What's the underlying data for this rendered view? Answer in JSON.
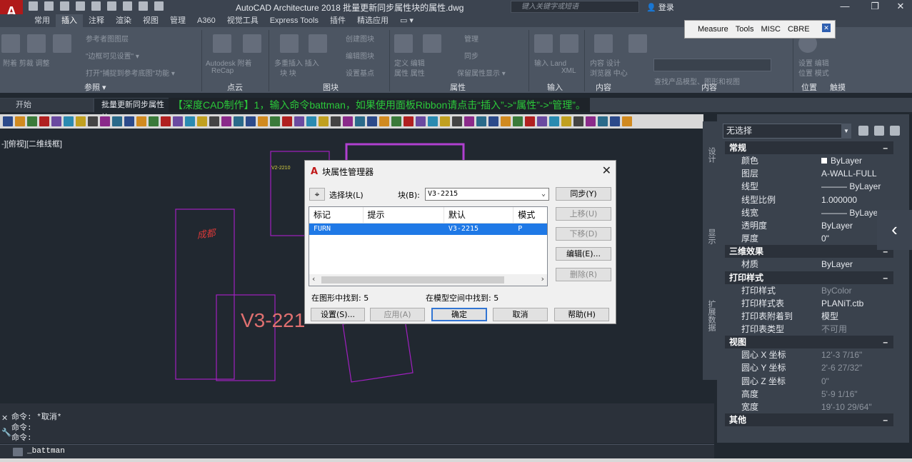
{
  "window": {
    "title": "AutoCAD Architecture 2018   批量更新同步属性块的属性.dwg",
    "search_placeholder": "键入关键字或短语",
    "login": "登录",
    "minimize": "—",
    "restore": "❐",
    "close": "✕"
  },
  "ribbon_tabs": [
    "常用",
    "插入",
    "注释",
    "渲染",
    "视图",
    "管理",
    "A360",
    "视觉工具",
    "Express Tools",
    "插件",
    "精选应用",
    "▭ ▾"
  ],
  "ribbon_active_tab": "插入",
  "floating_toolbar": [
    "Measure",
    "Tools",
    "MISC",
    "CBRE"
  ],
  "ribbon": {
    "panels": [
      "参照 ▾",
      "点云",
      "图块",
      "属性",
      "输入",
      "内容",
      "内容",
      "位置",
      "触摸"
    ],
    "faded_labels": {
      "ref1": "参考者图图层",
      "ref2": "\"边框可见设置\" ▾",
      "ref3": "打开\"捕捉到参考底图\"功能 ▾",
      "attach": "附着  剪裁  调整",
      "autodesk": "Autodesk  附着",
      "recap": "ReCap",
      "block_items": "多重插入  插入",
      "block_blocks": "块    块",
      "create": "创建图块",
      "edit": "编辑图块",
      "setbase": "设置基点",
      "manage": "管理",
      "sync": "同步",
      "hide": "保留属性显示 ▾",
      "define": "定义  编辑",
      "attr": "属性  属性",
      "import": "输入  Land",
      "xml": "XML",
      "content_browser": "内容  设计",
      "content_center": "浏览器  中心",
      "search_hint": "查找产品模型、图形和视图",
      "location": "设置  编辑",
      "location2": "位置  模式"
    }
  },
  "file_tabs": {
    "start": "开始",
    "doc": "批量更新同步属性块"
  },
  "banner": "【深度CAD制作】1，输入命令battman，如果使用面板Ribbon请点击“插入”->“属性”->“管理”。",
  "viewport_label": "-][俯视][二维线框]",
  "drawing": {
    "small_label": "V2-2210",
    "red_label": "成都",
    "big_label": "V3-221"
  },
  "dialog": {
    "title": "块属性管理器",
    "select_block": "选择块(L)",
    "block_label": "块(B):",
    "block_value": "V3-2215",
    "columns": [
      "标记",
      "提示",
      "默认",
      "模式"
    ],
    "rows": [
      {
        "tag": "FURN",
        "prompt": "",
        "default": "V3-2215",
        "mode": "P"
      }
    ],
    "buttons": {
      "sync": "同步(Y)",
      "move_up": "上移(U)",
      "move_down": "下移(D)",
      "edit": "编辑(E)...",
      "delete": "删除(R)",
      "settings": "设置(S)...",
      "apply": "应用(A)",
      "ok": "确定",
      "cancel": "取消",
      "help": "帮助(H)"
    },
    "found_drawing": "在图形中找到: 5",
    "found_model": "在模型空间中找到: 5"
  },
  "palette": {
    "selection": "无选择",
    "side_tabs": [
      "设计",
      "显示",
      "扩展数据"
    ],
    "sections": [
      {
        "title": "常规",
        "rows": [
          {
            "k": "颜色",
            "v": "ByLayer",
            "swatch": true
          },
          {
            "k": "图层",
            "v": "A-WALL-FULL"
          },
          {
            "k": "线型",
            "v": "——— ByLayer"
          },
          {
            "k": "线型比例",
            "v": "1.000000"
          },
          {
            "k": "线宽",
            "v": "——— ByLayer"
          },
          {
            "k": "透明度",
            "v": "ByLayer"
          },
          {
            "k": "厚度",
            "v": "0\""
          }
        ]
      },
      {
        "title": "三维效果",
        "rows": [
          {
            "k": "材质",
            "v": "ByLayer"
          }
        ]
      },
      {
        "title": "打印样式",
        "rows": [
          {
            "k": "打印样式",
            "v": "ByColor",
            "dim": true
          },
          {
            "k": "打印样式表",
            "v": "PLANiT.ctb"
          },
          {
            "k": "打印表附着到",
            "v": "模型"
          },
          {
            "k": "打印表类型",
            "v": "不可用",
            "dim": true
          }
        ]
      },
      {
        "title": "视图",
        "rows": [
          {
            "k": "圆心 X 坐标",
            "v": "12'-3 7/16\"",
            "dim": true
          },
          {
            "k": "圆心 Y 坐标",
            "v": "2'-6 27/32\"",
            "dim": true
          },
          {
            "k": "圆心 Z 坐标",
            "v": "0\"",
            "dim": true
          },
          {
            "k": "高度",
            "v": "5'-9 1/16\"",
            "dim": true
          },
          {
            "k": "宽度",
            "v": "19'-10 29/64\"",
            "dim": true
          }
        ]
      },
      {
        "title": "其他",
        "rows": []
      }
    ]
  },
  "command": {
    "history": [
      "命令: *取消*",
      "命令:",
      "命令:"
    ],
    "current": "_battman"
  },
  "colors": {
    "accent_blue": "#1f79e6",
    "banner_green": "#2bc83a",
    "magenta_lines": "#b020c0",
    "label_red": "#d83838"
  }
}
